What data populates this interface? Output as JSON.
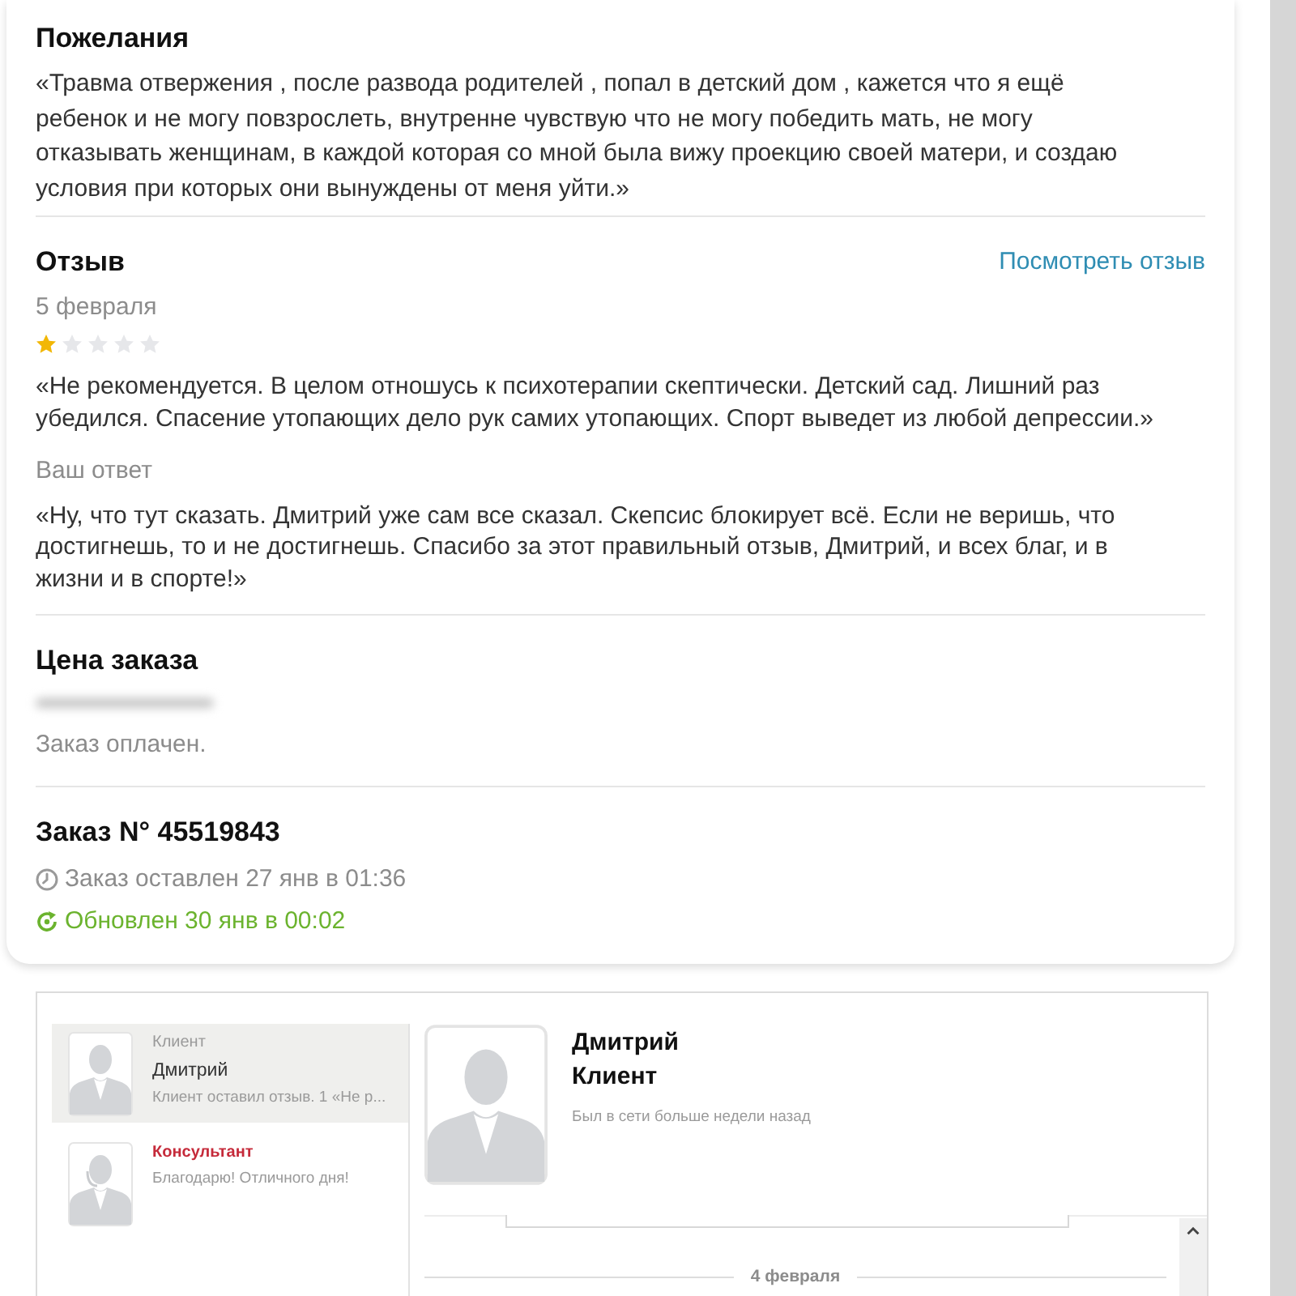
{
  "wishes": {
    "title": "Пожелания",
    "text": "«Травма отвержения , после развода родителей , попал в детский дом , кажется что я ещё ребенок и не могу повзрослеть, внутренне чувствую что не могу победить мать, не могу отказывать женщинам, в каждой которая со мной была вижу проекцию своей матери, и создаю условия при которых они вынуждены от меня уйти.»"
  },
  "review": {
    "title": "Отзыв",
    "link": "Посмотреть отзыв",
    "date": "5 февраля",
    "stars": 1,
    "text": "«Не рекомендуется. В целом отношусь к психотерапии скептически. Детский сад. Лишний раз убедился. Спасение утопающих дело рук самих утопающих. Спорт выведет из любой депрессии.»",
    "answer_label": "Ваш ответ",
    "answer": "«Ну, что тут сказать. Дмитрий уже сам все сказал. Скепсис блокирует всё. Если не веришь, что достигнешь, то и не достигнешь. Спасибо за этот правильный отзыв, Дмитрий, и всех благ, и в жизни и в спорте!»"
  },
  "price": {
    "title": "Цена заказа",
    "status": "Заказ оплачен."
  },
  "order": {
    "title": "Заказ N° 45519843",
    "created": "Заказ оставлен 27 янв в 01:36",
    "updated": "Обновлен 30 янв в 00:02"
  },
  "chat": {
    "conversations": [
      {
        "kind": "client",
        "role": "Клиент",
        "name": "Дмитрий",
        "preview": "Клиент оставил отзыв. 1 «Не р...",
        "selected": true
      },
      {
        "kind": "consultant",
        "role": "Консультант",
        "preview": "Благодарю! Отличного дня!",
        "selected": false
      }
    ],
    "profile": {
      "name": "Дмитрий",
      "role": "Клиент",
      "last_seen": "Был в сети больше недели назад"
    },
    "date_divider": "4 февраля"
  }
}
